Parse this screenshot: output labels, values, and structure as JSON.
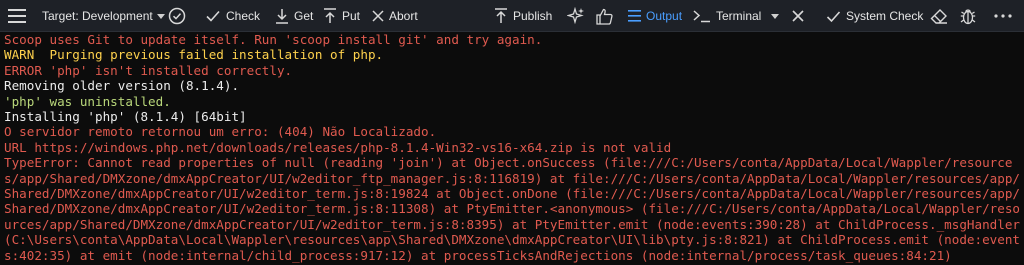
{
  "toolbar": {
    "target_label": "Target: Development",
    "check_label": "Check",
    "get_label": "Get",
    "put_label": "Put",
    "abort_label": "Abort",
    "publish_label": "Publish",
    "output_label": "Output",
    "terminal_label": "Terminal",
    "system_check_label": "System Check",
    "accent_color": "#4a9eff"
  },
  "console": {
    "lines": [
      {
        "text": "Scoop uses Git to update itself. Run 'scoop install git' and try again.",
        "kind": "err"
      },
      {
        "text": "WARN  Purging previous failed installation of php.",
        "kind": "warn"
      },
      {
        "text": "ERROR 'php' isn't installed correctly.",
        "kind": "err"
      },
      {
        "text": "Removing older version (8.1.4).",
        "kind": "norm"
      },
      {
        "text": "'php' was uninstalled.",
        "kind": "ok"
      },
      {
        "text": "Installing 'php' (8.1.4) [64bit]",
        "kind": "norm"
      },
      {
        "text": "O servidor remoto retornou um erro: (404) Não Localizado.",
        "kind": "err"
      },
      {
        "text": "URL https://windows.php.net/downloads/releases/php-8.1.4-Win32-vs16-x64.zip is not valid",
        "kind": "err"
      },
      {
        "text": "TypeError: Cannot read properties of null (reading 'join') at Object.onSuccess (file:///C:/Users/conta/AppData/Local/Wappler/resources/app/Shared/DMXzone/dmxAppCreator/UI/w2editor_ftp_manager.js:8:116819) at file:///C:/Users/conta/AppData/Local/Wappler/resources/app/Shared/DMXzone/dmxAppCreator/UI/w2editor_term.js:8:19824 at Object.onDone (file:///C:/Users/conta/AppData/Local/Wappler/resources/app/Shared/DMXzone/dmxAppCreator/UI/w2editor_term.js:8:11308) at PtyEmitter.<anonymous> (file:///C:/Users/conta/AppData/Local/Wappler/resources/app/Shared/DMXzone/dmxAppCreator/UI/w2editor_term.js:8:8395) at PtyEmitter.emit (node:events:390:28) at ChildProcess._msgHandler (C:\\Users\\conta\\AppData\\Local\\Wappler\\resources\\app\\Shared\\DMXzone\\dmxAppCreator\\UI\\lib\\pty.js:8:821) at ChildProcess.emit (node:events:402:35) at emit (node:internal/child_process:917:12) at processTicksAndRejections (node:internal/process/task_queues:84:21)",
        "kind": "err"
      }
    ]
  },
  "colors": {
    "error": "#e05a4f",
    "warning": "#ffd24d",
    "success": "#b9d77a",
    "normal": "#ececec"
  }
}
